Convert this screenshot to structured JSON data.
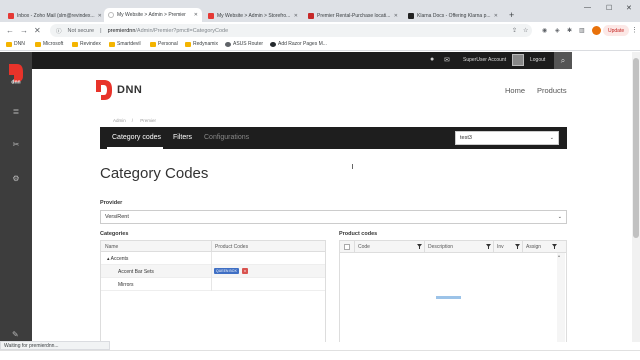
{
  "browser": {
    "tabs": [
      {
        "label": "Inbox - Zoho Mail (slm@revindex...",
        "favicon_color": "#e53935",
        "active": false
      },
      {
        "label": "My Website > Admin > Premier",
        "favicon_color": "#ffffff",
        "active": true
      },
      {
        "label": "My Website > Admin > Storefro...",
        "favicon_color": "#e53935",
        "active": false
      },
      {
        "label": "Premier Rental-Purchase locati...",
        "favicon_color": "#c62828",
        "active": false
      },
      {
        "label": "Klarna Docs - Offering Klarna p...",
        "favicon_color": "#222222",
        "active": false
      }
    ],
    "new_tab_icon": "plus-icon",
    "address": {
      "security_label": "Not secure",
      "host": "premierdnn",
      "path": "/Admin/Premier?pmctl=CategoryCode"
    },
    "update_label": "Update",
    "bookmarks": [
      {
        "label": "DNN",
        "icon": "folder-icon"
      },
      {
        "label": "Microsoft",
        "icon": "folder-icon"
      },
      {
        "label": "Revindex",
        "icon": "folder-icon"
      },
      {
        "label": "Smartdevil",
        "icon": "folder-icon"
      },
      {
        "label": "Personal",
        "icon": "folder-icon"
      },
      {
        "label": "Redynamix",
        "icon": "folder-icon"
      },
      {
        "label": "ASUS Router",
        "icon": "router-icon"
      },
      {
        "label": "Add Razor Pages M...",
        "icon": "github-icon"
      }
    ],
    "status_text": "Waiting for premierdnn..."
  },
  "persona_bar": {
    "user_name": "SuperUser Account",
    "logout_label": "Logout",
    "icons": [
      "notifications-icon",
      "chat-icon",
      "search-icon"
    ]
  },
  "site": {
    "logo_text": "DNN",
    "nav": [
      "Home",
      "Products"
    ]
  },
  "breadcrumb": [
    "Admin",
    "Premier"
  ],
  "module": {
    "tabs": [
      {
        "label": "Category codes",
        "active": true
      },
      {
        "label": "Filters",
        "active": false
      },
      {
        "label": "Configurations",
        "active": false
      }
    ],
    "store_select_value": "test3"
  },
  "page": {
    "title": "Category Codes",
    "provider_label": "Provider",
    "provider_value": "VersiRent",
    "categories_label": "Categories",
    "products_label": "Product codes"
  },
  "categories_grid": {
    "columns": [
      "Name",
      "Product Codes"
    ],
    "rows": [
      {
        "name": "▴ Accents",
        "indent": 1,
        "codes": []
      },
      {
        "name": "Accent Bar Sets",
        "indent": 2,
        "codes": [
          "QUEEN BOX"
        ]
      },
      {
        "name": "Mirrors",
        "indent": 2,
        "codes": []
      }
    ],
    "badge_remove": "x"
  },
  "products_grid": {
    "columns": [
      "Code",
      "Description",
      "Inv",
      "Assign"
    ]
  },
  "colors": {
    "dnn_red": "#e8332a",
    "persona_bar": "#1c1c1c",
    "rail": "#3d3d3d",
    "badge_blue": "#3f6fc4"
  }
}
